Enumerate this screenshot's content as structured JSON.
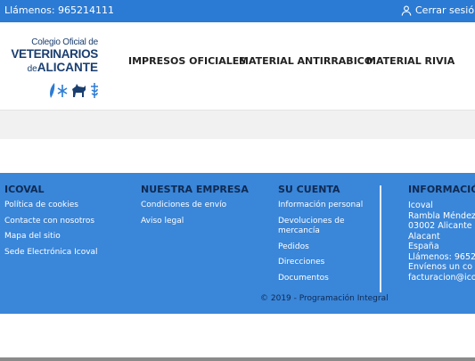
{
  "topbar": {
    "phone": "Llámenos: 965214111",
    "logout": "Cerrar sesión"
  },
  "logo": {
    "line1": "Colegio Oficial de",
    "line2": "VETERINARIOS",
    "line3_prefix": "de",
    "line3_city": "ALICANTE"
  },
  "nav": {
    "items": [
      "IMPRESOS OFICIALES",
      "MATERIAL ANTIRRABICO",
      "MATERIAL RIVIA"
    ]
  },
  "footer": {
    "col1": {
      "title": "ICOVAL",
      "links": [
        "Política de cookies",
        "Contacte con nosotros",
        "Mapa del sitio",
        "Sede Electrónica Icoval"
      ]
    },
    "col2": {
      "title": "NUESTRA EMPRESA",
      "links": [
        "Condiciones de envío",
        "Aviso legal"
      ]
    },
    "col3": {
      "title": "SU CUENTA",
      "links": [
        "Información personal",
        "Devoluciones de mercancía",
        "Pedidos",
        "Direcciones",
        "Documentos"
      ]
    },
    "col4": {
      "title": "INFORMACIÓN",
      "lines": [
        "Icoval",
        "Rambla Méndez",
        "03002 Alicante",
        "Alacant",
        "España",
        "Llámenos: 9652",
        "Envíenos un co",
        "facturacion@ico"
      ]
    },
    "copyright": "© 2019 - Programación Integral"
  },
  "colors": {
    "primary": "#2b7bd4",
    "footer_bg": "#3a86d9",
    "footer_heading": "#0f2a52",
    "logo_blue": "#1a3e6f"
  }
}
